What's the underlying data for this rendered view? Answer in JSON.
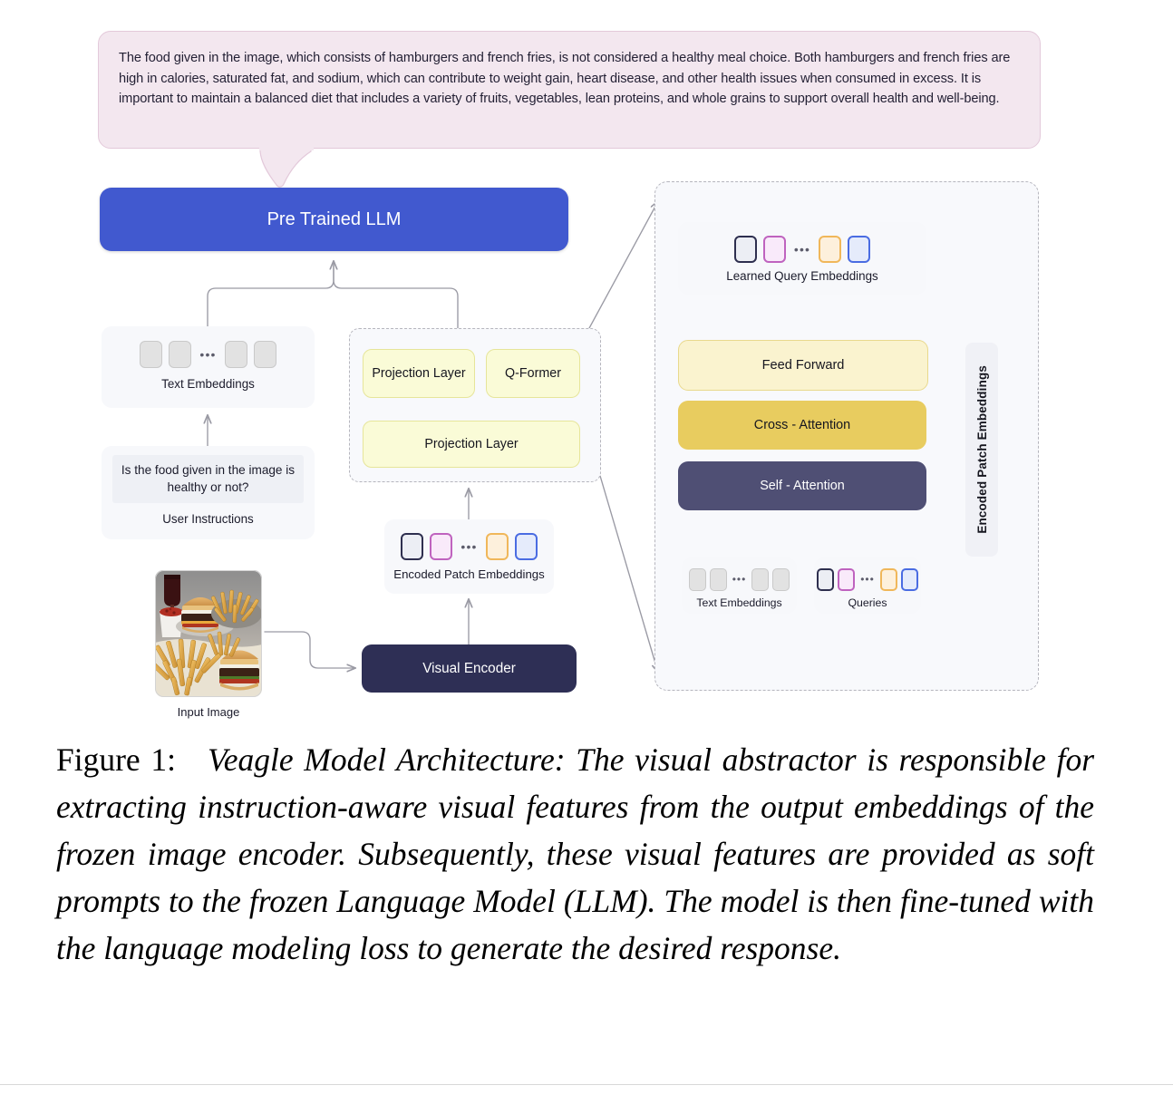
{
  "response": {
    "text": "The food given in the image, which consists of hamburgers and french fries, is not considered a healthy meal choice. Both hamburgers and french fries are high in calories, saturated fat, and sodium, which can contribute to weight gain, heart disease, and other health issues when consumed in excess. It is important to maintain a balanced diet that includes a variety of fruits, vegetables, lean proteins, and whole grains to support overall health and well-being."
  },
  "nodes": {
    "llm": "Pre Trained LLM",
    "text_embeddings": "Text Embeddings",
    "user_prompt": "Is the food given in the image is healthy or not?",
    "user_instructions": "User Instructions",
    "projection_layer_small": "Projection Layer",
    "q_former": "Q-Former",
    "projection_layer_big": "Projection Layer",
    "encoded_patch_embeddings": "Encoded Patch Embeddings",
    "visual_encoder": "Visual Encoder",
    "input_image": "Input Image",
    "learned_query_embeddings": "Learned Query Embeddings",
    "feed_forward": "Feed Forward",
    "cross_attention": "Cross - Attention",
    "self_attention": "Self - Attention",
    "encoded_patch_embeddings_vertical": "Encoded Patch Embeddings",
    "detail_text_embeddings": "Text Embeddings",
    "queries": "Queries",
    "ellipsis": "•••"
  },
  "caption": {
    "label": "Figure 1:",
    "text": "Veagle Model Architecture: The visual abstractor is responsible for extracting instruction-aware visual features from the output embeddings of the frozen image encoder. Subsequently, these visual features are provided as soft prompts to the frozen Language Model (LLM). The model is then fine-tuned with the language modeling loss to generate the desired response."
  },
  "colors": {
    "bubble_fill": "#f3e7ef",
    "bubble_border": "#e3c9da",
    "llm_blue": "#4159cf",
    "visual_encoder_navy": "#2e2f55",
    "self_attention_navy": "#4f4f74",
    "cross_attention_gold": "#e8cc5f",
    "feed_forward_yellow": "#faf3cf",
    "projection_yellow": "#fafbd7",
    "panel_gray": "#f7f8fb",
    "chip_gray": "#e2e2e2",
    "chip_navy_border": "#2e2f4f",
    "chip_pink_border": "#bf63bf",
    "chip_amber_border": "#f0b75a",
    "chip_blue_border": "#4a6ce2",
    "arrow_gray": "#9a9aa4"
  }
}
